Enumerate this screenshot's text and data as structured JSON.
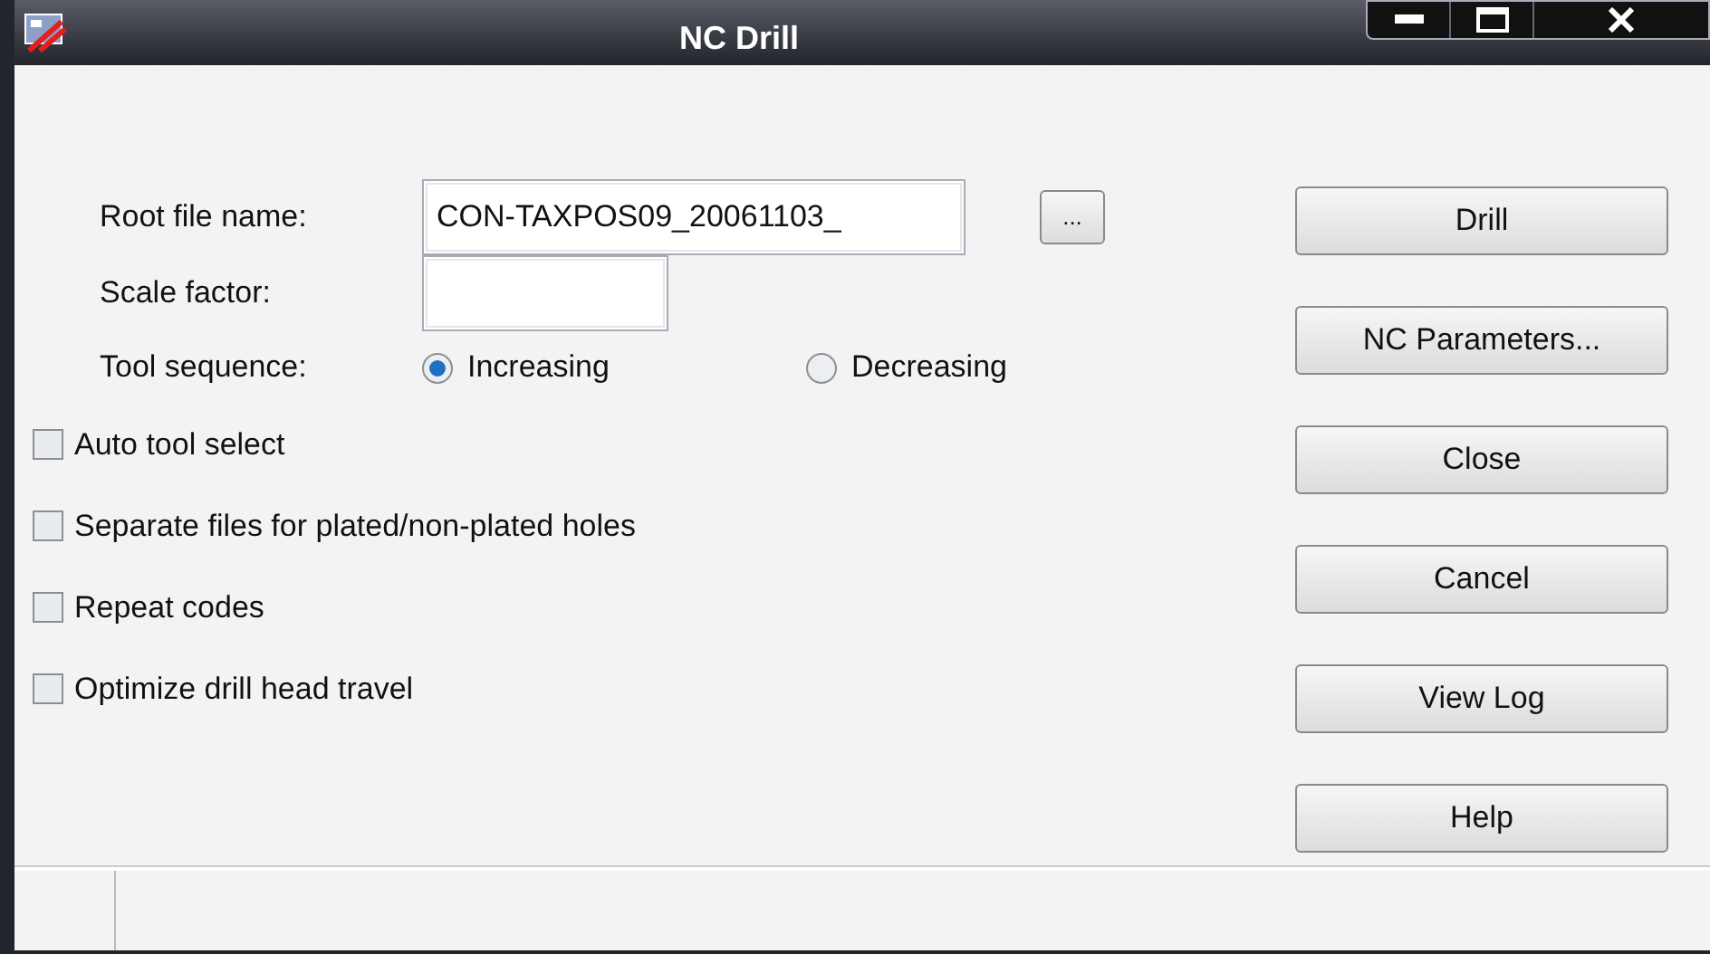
{
  "window": {
    "title": "NC Drill"
  },
  "fields": [
    {
      "label": "Root file name:",
      "value": "CON-TAXPOS09_20061103_",
      "browse": "..."
    },
    {
      "label": "Scale factor:"
    }
  ],
  "tool_sequence": {
    "label": "Tool sequence:",
    "options": [
      {
        "label": "Increasing",
        "selected": true
      },
      {
        "label": "Decreasing",
        "selected": false
      }
    ]
  },
  "options": [
    {
      "label": "Auto tool select",
      "checked": false
    },
    {
      "label": "Separate files for plated/non-plated holes",
      "checked": false
    },
    {
      "label": "Repeat codes",
      "checked": false
    },
    {
      "label": "Optimize drill head travel",
      "checked": false
    }
  ],
  "buttons": [
    "Drill",
    "NC Parameters...",
    "Close",
    "Cancel",
    "View Log",
    "Help"
  ]
}
